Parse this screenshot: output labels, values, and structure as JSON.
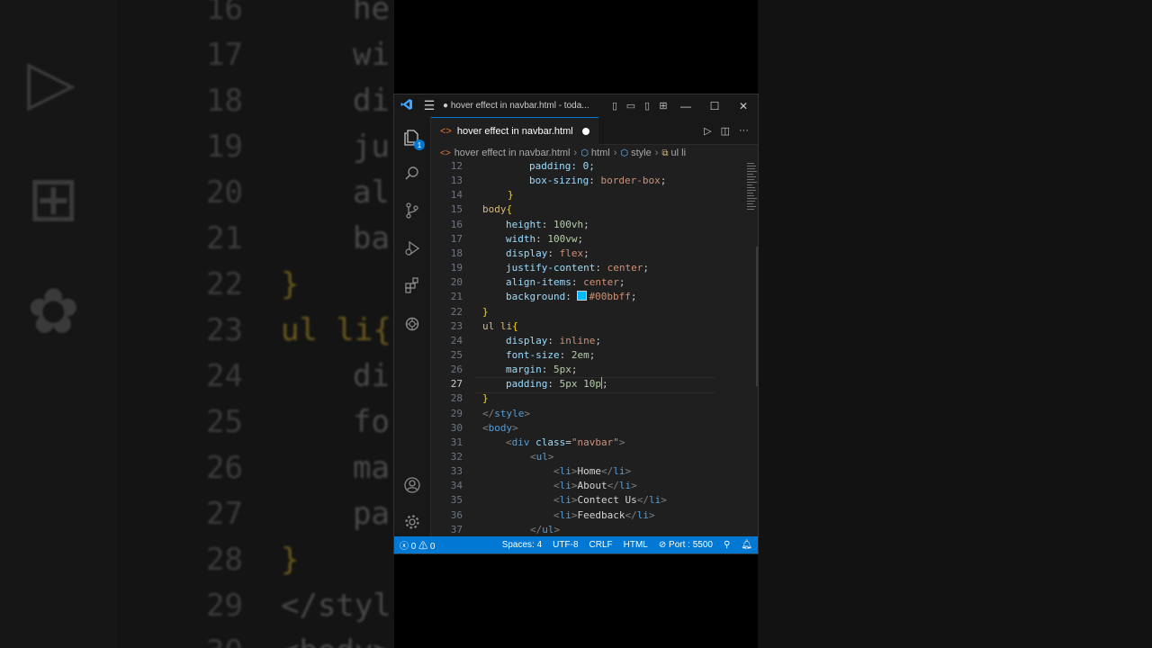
{
  "window": {
    "title": "● hover effect in navbar.html - toda...",
    "app_icon": "vscode-logo-icon"
  },
  "activity_bar": {
    "explorer_badge": "1",
    "icons": [
      "files-icon",
      "search-icon",
      "source-control-icon",
      "run-debug-icon",
      "extensions-icon",
      "chatgpt-icon",
      "account-icon",
      "settings-gear-icon"
    ]
  },
  "tab": {
    "label": "hover effect in navbar.html",
    "modified": true
  },
  "breadcrumb": {
    "items": [
      "hover effect in navbar.html",
      "html",
      "style",
      "ul li"
    ]
  },
  "editor": {
    "current_line": 27,
    "lines": [
      {
        "n": "12",
        "segments": [
          {
            "t": "padding: 0;",
            "c": "t-prop"
          }
        ]
      },
      {
        "n": "13",
        "segments": [
          {
            "t": "box-sizing",
            "c": "t-prop"
          },
          {
            "t": ": ",
            "c": "t-pun"
          },
          {
            "t": "border-box",
            "c": "t-val"
          },
          {
            "t": ";",
            "c": "t-pun"
          }
        ]
      },
      {
        "n": "14",
        "segments": [
          {
            "t": "}",
            "c": "t-br1"
          }
        ]
      },
      {
        "n": "15",
        "segments": [
          {
            "t": "body",
            "c": "t-sel"
          },
          {
            "t": "{",
            "c": "t-br1"
          }
        ]
      },
      {
        "n": "16",
        "segments": [
          {
            "t": "height",
            "c": "t-prop"
          },
          {
            "t": ": ",
            "c": "t-pun"
          },
          {
            "t": "100vh",
            "c": "t-num"
          },
          {
            "t": ";",
            "c": "t-pun"
          }
        ]
      },
      {
        "n": "17",
        "segments": [
          {
            "t": "width",
            "c": "t-prop"
          },
          {
            "t": ": ",
            "c": "t-pun"
          },
          {
            "t": "100vw",
            "c": "t-num"
          },
          {
            "t": ";",
            "c": "t-pun"
          }
        ]
      },
      {
        "n": "18",
        "segments": [
          {
            "t": "display",
            "c": "t-prop"
          },
          {
            "t": ": ",
            "c": "t-pun"
          },
          {
            "t": "flex",
            "c": "t-val"
          },
          {
            "t": ";",
            "c": "t-pun"
          }
        ]
      },
      {
        "n": "19",
        "segments": [
          {
            "t": "justify-content",
            "c": "t-prop"
          },
          {
            "t": ": ",
            "c": "t-pun"
          },
          {
            "t": "center",
            "c": "t-val"
          },
          {
            "t": ";",
            "c": "t-pun"
          }
        ]
      },
      {
        "n": "20",
        "segments": [
          {
            "t": "align-items",
            "c": "t-prop"
          },
          {
            "t": ": ",
            "c": "t-pun"
          },
          {
            "t": "center",
            "c": "t-val"
          },
          {
            "t": ";",
            "c": "t-pun"
          }
        ]
      },
      {
        "n": "21",
        "segments": [
          {
            "t": "background",
            "c": "t-prop"
          },
          {
            "t": ": ",
            "c": "t-pun"
          },
          {
            "t": "SWATCH",
            "c": "swatch"
          },
          {
            "t": "#00bbff",
            "c": "t-val"
          },
          {
            "t": ";",
            "c": "t-pun"
          }
        ]
      },
      {
        "n": "22",
        "segments": [
          {
            "t": "}",
            "c": "t-br1"
          }
        ]
      },
      {
        "n": "23",
        "segments": [
          {
            "t": "ul li",
            "c": "t-sel"
          },
          {
            "t": "{",
            "c": "t-br1"
          }
        ]
      },
      {
        "n": "24",
        "segments": [
          {
            "t": "display",
            "c": "t-prop"
          },
          {
            "t": ": ",
            "c": "t-pun"
          },
          {
            "t": "inline",
            "c": "t-val"
          },
          {
            "t": ";",
            "c": "t-pun"
          }
        ]
      },
      {
        "n": "25",
        "segments": [
          {
            "t": "font-size",
            "c": "t-prop"
          },
          {
            "t": ": ",
            "c": "t-pun"
          },
          {
            "t": "2em",
            "c": "t-num"
          },
          {
            "t": ";",
            "c": "t-pun"
          }
        ]
      },
      {
        "n": "26",
        "segments": [
          {
            "t": "margin",
            "c": "t-prop"
          },
          {
            "t": ": ",
            "c": "t-pun"
          },
          {
            "t": "5px",
            "c": "t-num"
          },
          {
            "t": ";",
            "c": "t-pun"
          }
        ]
      },
      {
        "n": "27",
        "segments": [
          {
            "t": "padding",
            "c": "t-prop"
          },
          {
            "t": ": ",
            "c": "t-pun"
          },
          {
            "t": "5px 10p",
            "c": "t-num"
          },
          {
            "t": "CARET",
            "c": "caret"
          },
          {
            "t": ";",
            "c": "t-pun"
          }
        ]
      },
      {
        "n": "28",
        "segments": [
          {
            "t": "}",
            "c": "t-br1"
          }
        ]
      },
      {
        "n": "29",
        "segments": [
          {
            "t": "</",
            "c": "t-ang"
          },
          {
            "t": "style",
            "c": "t-tag"
          },
          {
            "t": ">",
            "c": "t-ang"
          }
        ]
      },
      {
        "n": "30",
        "segments": [
          {
            "t": "<",
            "c": "t-ang"
          },
          {
            "t": "body",
            "c": "t-tag"
          },
          {
            "t": ">",
            "c": "t-ang"
          }
        ]
      },
      {
        "n": "31",
        "segments": [
          {
            "t": "<",
            "c": "t-ang"
          },
          {
            "t": "div",
            "c": "t-tag"
          },
          {
            "t": " class",
            "c": "t-attr"
          },
          {
            "t": "=",
            "c": "t-pun"
          },
          {
            "t": "\"navbar\"",
            "c": "t-str"
          },
          {
            "t": ">",
            "c": "t-ang"
          }
        ]
      },
      {
        "n": "32",
        "segments": [
          {
            "t": "<",
            "c": "t-ang"
          },
          {
            "t": "ul",
            "c": "t-tag"
          },
          {
            "t": ">",
            "c": "t-ang"
          }
        ]
      },
      {
        "n": "33",
        "segments": [
          {
            "t": "<",
            "c": "t-ang"
          },
          {
            "t": "li",
            "c": "t-tag"
          },
          {
            "t": ">",
            "c": "t-ang"
          },
          {
            "t": "Home",
            "c": "t-txt"
          },
          {
            "t": "</",
            "c": "t-ang"
          },
          {
            "t": "li",
            "c": "t-tag"
          },
          {
            "t": ">",
            "c": "t-ang"
          }
        ]
      },
      {
        "n": "34",
        "segments": [
          {
            "t": "<",
            "c": "t-ang"
          },
          {
            "t": "li",
            "c": "t-tag"
          },
          {
            "t": ">",
            "c": "t-ang"
          },
          {
            "t": "About",
            "c": "t-txt"
          },
          {
            "t": "</",
            "c": "t-ang"
          },
          {
            "t": "li",
            "c": "t-tag"
          },
          {
            "t": ">",
            "c": "t-ang"
          }
        ]
      },
      {
        "n": "35",
        "segments": [
          {
            "t": "<",
            "c": "t-ang"
          },
          {
            "t": "li",
            "c": "t-tag"
          },
          {
            "t": ">",
            "c": "t-ang"
          },
          {
            "t": "Contect Us",
            "c": "t-txt"
          },
          {
            "t": "</",
            "c": "t-ang"
          },
          {
            "t": "li",
            "c": "t-tag"
          },
          {
            "t": ">",
            "c": "t-ang"
          }
        ]
      },
      {
        "n": "36",
        "segments": [
          {
            "t": "<",
            "c": "t-ang"
          },
          {
            "t": "li",
            "c": "t-tag"
          },
          {
            "t": ">",
            "c": "t-ang"
          },
          {
            "t": "Feedback",
            "c": "t-txt"
          },
          {
            "t": "</",
            "c": "t-ang"
          },
          {
            "t": "li",
            "c": "t-tag"
          },
          {
            "t": ">",
            "c": "t-ang"
          }
        ]
      },
      {
        "n": "37",
        "segments": [
          {
            "t": "</",
            "c": "t-ang"
          },
          {
            "t": "ul",
            "c": "t-tag"
          },
          {
            "t": ">",
            "c": "t-ang"
          }
        ]
      }
    ]
  },
  "status_bar": {
    "errors": "0",
    "warnings": "0",
    "spaces": "Spaces: 4",
    "encoding": "UTF-8",
    "eol": "CRLF",
    "language": "HTML",
    "port": "Port : 5500"
  },
  "background": {
    "line_numbers": [
      "16",
      "17",
      "18",
      "19",
      "20",
      "21",
      "22",
      "23",
      "24",
      "25",
      "26",
      "27",
      "28",
      "29",
      "30"
    ],
    "code": [
      "he",
      "wi",
      "di",
      "ju",
      "al",
      "ba",
      "}",
      "ul li{",
      "di",
      "fo",
      "ma",
      "pa",
      "}",
      "</styl",
      "<body>"
    ]
  },
  "colors": {
    "accent": "#0078d4",
    "editor_bg": "#1f1f1f",
    "swatch": "#00bbff"
  }
}
